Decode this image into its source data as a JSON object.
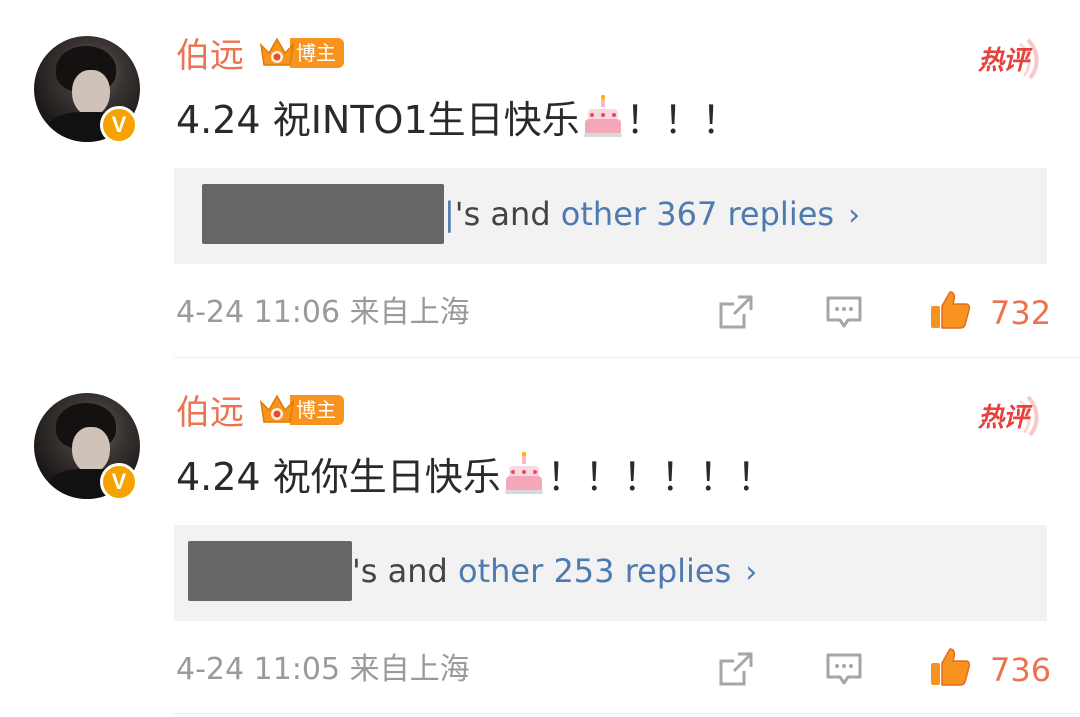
{
  "colors": {
    "username": "#eb7350",
    "link": "#4e7ab0",
    "meta": "#9a9a9a",
    "hot": "#e8413d",
    "like": "#eb7350"
  },
  "comments": [
    {
      "username": "伯远",
      "host_badge": "博主",
      "hot_tag": "热评",
      "content_prefix": "4.24 祝INTO1生日快乐",
      "content_suffix": "！！！",
      "emoji": "cake-icon",
      "reply_cursor": "|",
      "reply_plain": "'s and ",
      "reply_link": "other 367 replies",
      "reply_chevron": "›",
      "meta": "4-24 11:06 来自上海",
      "likes": "732"
    },
    {
      "username": "伯远",
      "host_badge": "博主",
      "hot_tag": "热评",
      "content_prefix": "4.24 祝你生日快乐",
      "content_suffix": "！！！！！！",
      "emoji": "cake-icon",
      "reply_cursor": "",
      "reply_plain": "'s and ",
      "reply_link": "other 253 replies",
      "reply_chevron": "›",
      "meta": "4-24 11:05 来自上海",
      "likes": "736"
    }
  ]
}
